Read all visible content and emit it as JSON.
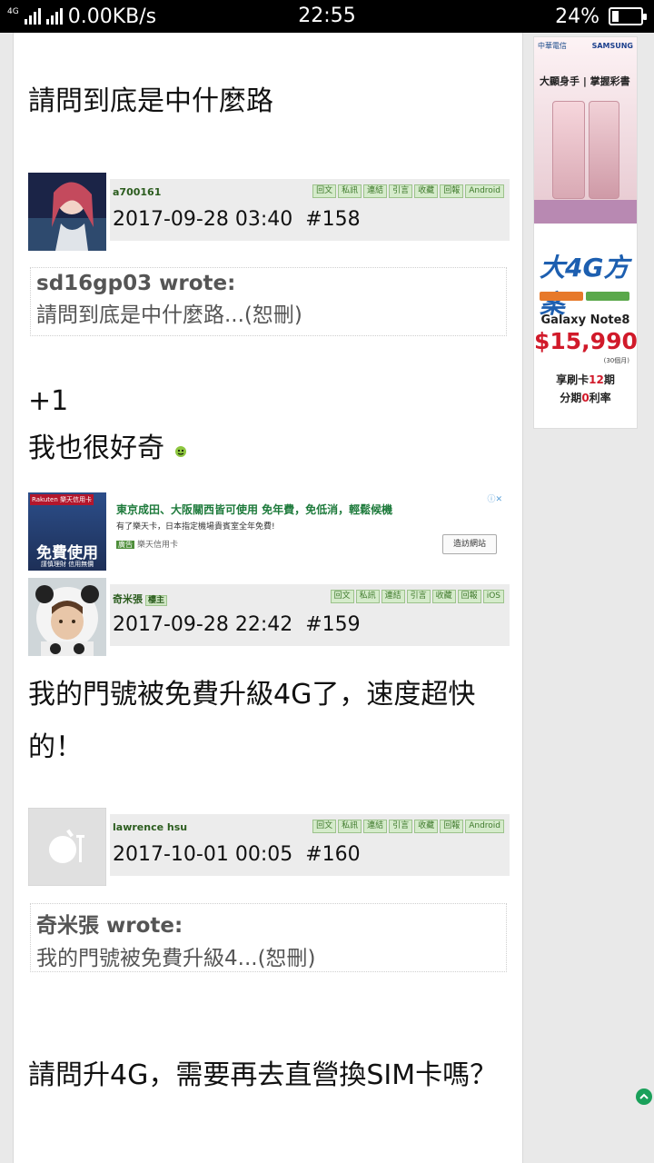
{
  "status_bar": {
    "network_type": "4G",
    "speed": "0.00KB/s",
    "time": "22:55",
    "battery": "24%",
    "battery_level": 0.24
  },
  "top_text": "請問到底是中什麼路",
  "posts": [
    {
      "username": "a700161",
      "actions": [
        "回文",
        "私訊",
        "連結",
        "引言",
        "收藏",
        "回報",
        "Android"
      ],
      "date": "2017-09-28 03:40",
      "number": "#158",
      "quote_title": "sd16gp03 wrote:",
      "quote_body": "請問到底是中什麼路...(恕刪)",
      "body_line1": "+1",
      "body_line2": "我也很好奇"
    },
    {
      "username": "奇米張",
      "owner_badge": "樓主",
      "actions": [
        "回文",
        "私訊",
        "連結",
        "引言",
        "收藏",
        "回報",
        "iOS"
      ],
      "date": "2017-09-28 22:42",
      "number": "#159",
      "body": "我的門號被免費升級4G了，速度超快的！"
    },
    {
      "username": "lawrence hsu",
      "actions": [
        "回文",
        "私訊",
        "連結",
        "引言",
        "收藏",
        "回報",
        "Android"
      ],
      "date": "2017-10-01 00:05",
      "number": "#160",
      "quote_title": "奇米張 wrote:",
      "quote_body": "我的門號被免費升級4...(恕刪)",
      "body": "請問升4G，需要再去直營換SIM卡嗎？"
    }
  ],
  "inline_ad": {
    "thumb_badge": "Rakuten 樂天信用卡",
    "thumb_big": "免費使用",
    "thumb_small": "謹慎理財 信用無價",
    "title": "東京成田、大阪關西皆可使用 免年費，免低消，輕鬆候機",
    "desc": "有了樂天卡，日本指定機場貴賓室全年免費!",
    "label": "廣告",
    "source": "樂天信用卡",
    "visit": "造訪網站",
    "close": "ⓘ✕"
  },
  "side_ad1": {
    "brand": "中華電信",
    "brand2": "SAMSUNG",
    "slogan": "大顯身手 | 掌握彩書"
  },
  "side_ad2": {
    "logo": "大4G方案",
    "model": "Galaxy Note8",
    "price": "$15,990",
    "months": "(30個月)",
    "line1_a": "享刷卡",
    "line1_b": "12",
    "line1_c": "期",
    "line2_a": "分期",
    "line2_b": "0",
    "line2_c": "利率"
  }
}
